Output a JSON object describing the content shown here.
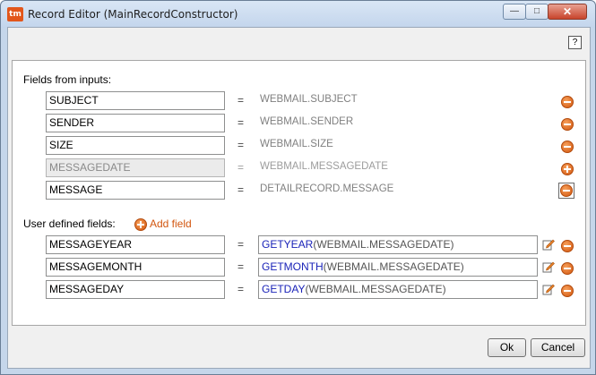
{
  "window": {
    "title": "Record Editor (MainRecordConstructor)",
    "app_icon": "tm-logo-icon",
    "controls": {
      "minimize": "—",
      "maximize": "□",
      "close": "✕"
    },
    "help_label": "?"
  },
  "inputs_section": {
    "label": "Fields from inputs:",
    "rows": [
      {
        "name": "SUBJECT",
        "eq": "=",
        "source": "WEBMAIL.SUBJECT",
        "action_icon": "remove-icon",
        "disabled": false
      },
      {
        "name": "SENDER",
        "eq": "=",
        "source": "WEBMAIL.SENDER",
        "action_icon": "remove-icon",
        "disabled": false
      },
      {
        "name": "SIZE",
        "eq": "=",
        "source": "WEBMAIL.SIZE",
        "action_icon": "remove-icon",
        "disabled": false
      },
      {
        "name": "MESSAGEDATE",
        "eq": "=",
        "source": "WEBMAIL.MESSAGEDATE",
        "action_icon": "add-icon",
        "disabled": true
      },
      {
        "name": "MESSAGE",
        "eq": "=",
        "source": "DETAILRECORD.MESSAGE",
        "action_icon": "remove-icon",
        "disabled": false
      }
    ]
  },
  "user_section": {
    "label": "User defined fields:",
    "add_field_label": "Add field",
    "rows": [
      {
        "name": "MESSAGEYEAR",
        "eq": "=",
        "fn": "GETYEAR",
        "arg": "(WEBMAIL.MESSAGEDATE)"
      },
      {
        "name": "MESSAGEMONTH",
        "eq": "=",
        "fn": "GETMONTH",
        "arg": "(WEBMAIL.MESSAGEDATE)"
      },
      {
        "name": "MESSAGEDAY",
        "eq": "=",
        "fn": "GETDAY",
        "arg": "(WEBMAIL.MESSAGEDATE)"
      }
    ]
  },
  "footer": {
    "ok_label": "Ok",
    "cancel_label": "Cancel"
  },
  "colors": {
    "accent": "#d2560f",
    "function": "#1a23b8"
  }
}
